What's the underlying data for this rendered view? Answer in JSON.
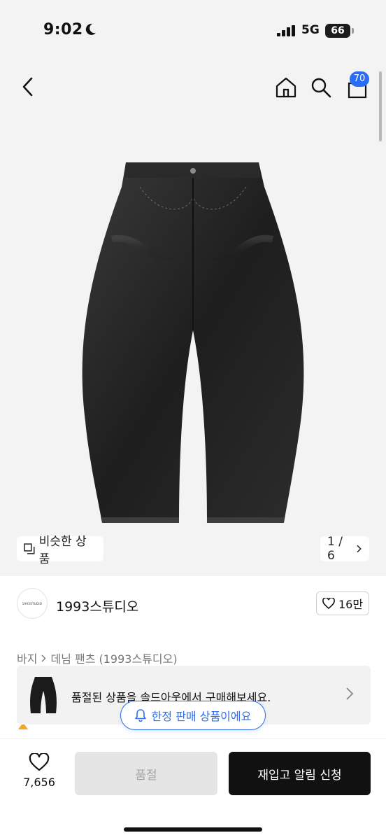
{
  "status_bar": {
    "time": "9:02",
    "network": "5G",
    "battery": "66"
  },
  "nav": {
    "cart_count": "70"
  },
  "gallery": {
    "similar_label": "비슷한 상품",
    "page_indicator": "1 / 6"
  },
  "brand": {
    "logo_text": "1993STUDIO",
    "name": "1993스튜디오",
    "like_count": "16만"
  },
  "breadcrumb": {
    "category": "바지",
    "subcategory": "데님 팬츠 (1993스튜디오)"
  },
  "banner": {
    "text": "품절된 상품을 솔드아웃에서 구매해보세요."
  },
  "limited": {
    "label": "한정 판매 상품이에요"
  },
  "bottom": {
    "wish_count": "7,656",
    "soldout_label": "품절",
    "restock_label": "재입고 알림 신청"
  },
  "icons": {
    "back": "chevron-left-icon",
    "home": "home-icon",
    "search": "search-icon",
    "cart": "shopping-bag-icon",
    "similar": "copy-icon",
    "heart": "heart-icon",
    "bell": "bell-icon"
  },
  "colors": {
    "accent": "#2f6fed",
    "cart_badge": "#2b6cf6",
    "cta": "#111111"
  }
}
